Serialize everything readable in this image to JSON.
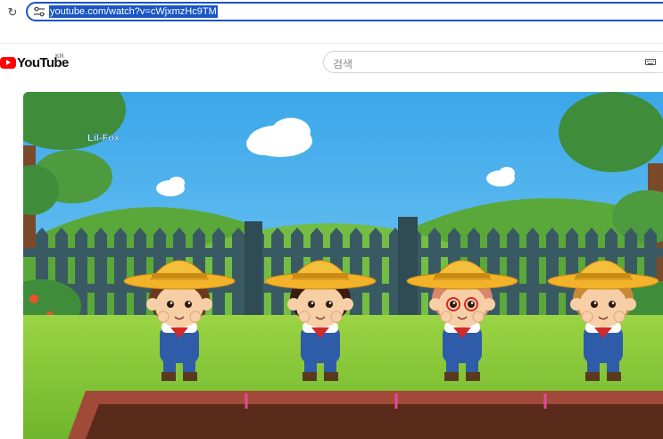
{
  "browser": {
    "url": "youtube.com/watch?v=cWjxmzHc9TM",
    "reload_icon": "reload-icon",
    "site_info_icon": "tune-icon"
  },
  "youtube": {
    "logo_text": "YouTube",
    "country_code": "KR",
    "search_placeholder": "검색",
    "keyboard_icon": "keyboard-icon"
  },
  "video": {
    "watermark": "Lil-Fox",
    "colors": {
      "sky": "#4fb6ee",
      "grass": "#8ccf3a",
      "fence": "#3a5a63",
      "hat": "#f2b22a",
      "overalls": "#2f5ca8",
      "soil": "#5a2a1a"
    }
  }
}
